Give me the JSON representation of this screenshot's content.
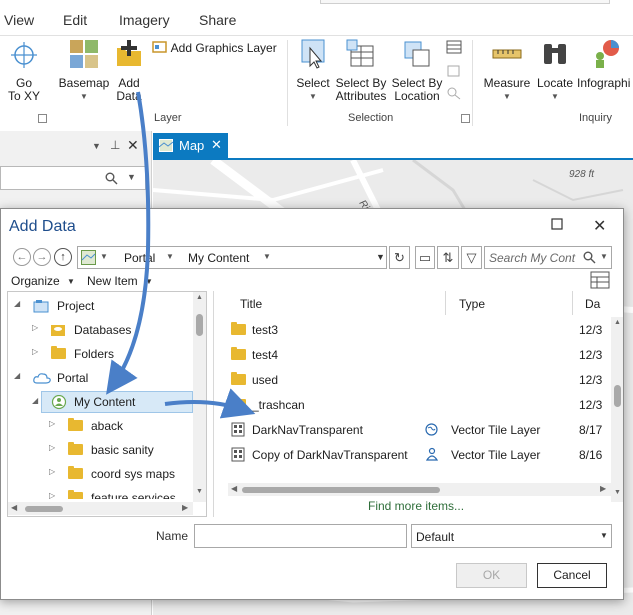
{
  "menu": [
    "View",
    "Edit",
    "Imagery",
    "Share"
  ],
  "ribbon": {
    "goto_xy": "Go\nTo XY",
    "basemap": "Basemap",
    "add_data": "Add\nData",
    "add_graphics_layer": "Add Graphics Layer",
    "select": "Select",
    "select_by_attributes": "Select By\nAttributes",
    "select_by_location": "Select By\nLocation",
    "measure": "Measure",
    "locate": "Locate",
    "infographics": "Infographi",
    "groups": {
      "layer": "Layer",
      "selection": "Selection",
      "inquiry": "Inquiry"
    }
  },
  "map": {
    "tab_label": "Map",
    "elevation_label": "928 ft",
    "street_label": "River"
  },
  "dialog": {
    "title": "Add Data",
    "path": {
      "root": "Portal",
      "location": "My Content"
    },
    "search_placeholder": "Search My Cont",
    "organize": "Organize",
    "new_item": "New Item",
    "tree": [
      {
        "label": "Project",
        "level": 0,
        "expanded": true,
        "icon": "project-icon"
      },
      {
        "label": "Databases",
        "level": 1,
        "expanded": false,
        "icon": "database-icon"
      },
      {
        "label": "Folders",
        "level": 1,
        "expanded": false,
        "icon": "folder-icon"
      },
      {
        "label": "Portal",
        "level": 0,
        "expanded": true,
        "icon": "cloud-icon"
      },
      {
        "label": "My Content",
        "level": 1,
        "expanded": true,
        "icon": "my-content-icon",
        "selected": true
      },
      {
        "label": "aback",
        "level": 2,
        "expanded": false,
        "icon": "folder-icon"
      },
      {
        "label": "basic sanity",
        "level": 2,
        "expanded": false,
        "icon": "folder-icon"
      },
      {
        "label": "coord sys maps",
        "level": 2,
        "expanded": false,
        "icon": "folder-icon"
      },
      {
        "label": "feature services",
        "level": 2,
        "expanded": false,
        "icon": "folder-icon"
      }
    ],
    "columns": {
      "title": "Title",
      "type": "Type",
      "date": "Da"
    },
    "items": [
      {
        "title": "test3",
        "type": "",
        "date": "12/3",
        "icon": "folder-icon"
      },
      {
        "title": "test4",
        "type": "",
        "date": "12/3",
        "icon": "folder-icon"
      },
      {
        "title": "used",
        "type": "",
        "date": "12/3",
        "icon": "folder-icon"
      },
      {
        "title": "_trashcan",
        "type": "",
        "date": "12/3",
        "icon": "folder-icon"
      },
      {
        "title": "DarkNavTransparent",
        "type": "Vector Tile Layer",
        "date": "8/17",
        "icon": "vector-tile-icon",
        "status_icon": "shared-globe-icon"
      },
      {
        "title": "Copy of DarkNavTransparent",
        "type": "Vector Tile Layer",
        "date": "8/16",
        "icon": "vector-tile-icon",
        "status_icon": "private-user-icon"
      }
    ],
    "find_more": "Find more items...",
    "name_label": "Name",
    "name_value": "",
    "filter_value": "Default",
    "ok": "OK",
    "cancel": "Cancel"
  },
  "colors": {
    "accent": "#0c7ac1",
    "folder": "#e8b830",
    "arrow": "#4a7fc8"
  }
}
